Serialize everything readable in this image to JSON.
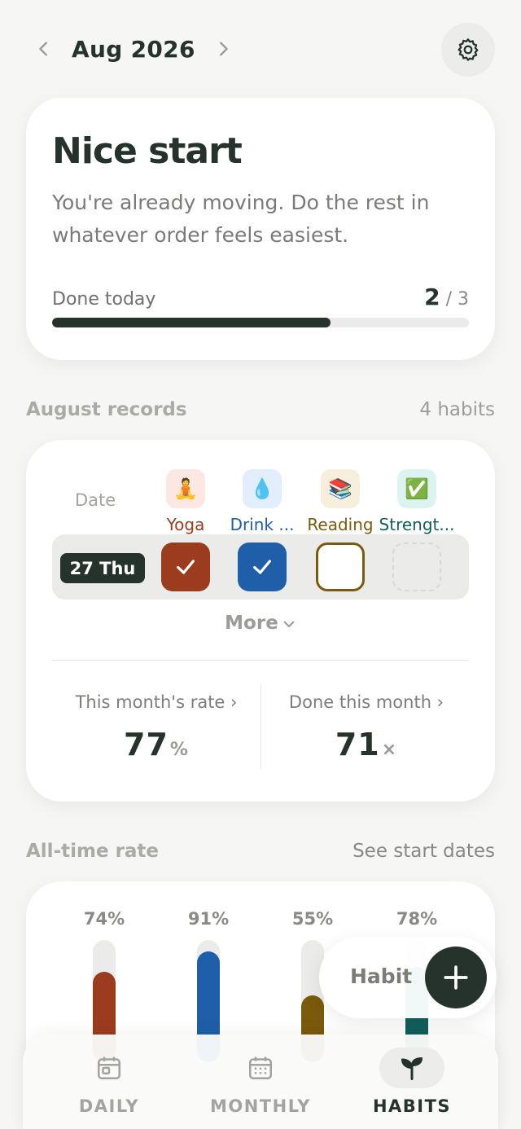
{
  "header": {
    "month": "Aug 2026"
  },
  "hero": {
    "title": "Nice start",
    "subtitle": "You're already moving. Do the rest in whatever order feels easiest.",
    "progress_label": "Done today",
    "done": "2",
    "separator": "/",
    "total": "3",
    "progress_fraction": 0.667
  },
  "records": {
    "title": "August records",
    "habit_count": "4 habits",
    "date_header": "Date",
    "habits": [
      {
        "name": "Yoga",
        "emoji": "🧘",
        "color": "#9b3c1e",
        "bg": "#fde7e3"
      },
      {
        "name": "Drink ...",
        "emoji": "💧",
        "color": "#1f5ea8",
        "bg": "#e3eefc"
      },
      {
        "name": "Reading",
        "emoji": "📚",
        "color": "#7a5a0c",
        "bg": "#f7eedc"
      },
      {
        "name": "Strengt...",
        "emoji": "✅",
        "color": "#12605c",
        "bg": "#dcf3f1"
      }
    ],
    "row": {
      "date": "27 Thu",
      "states": [
        "done",
        "done",
        "empty",
        "empty"
      ]
    },
    "more_label": "More",
    "rate_label": "This month's rate",
    "rate_value": "77",
    "rate_unit": "%",
    "done_label": "Done this month",
    "done_value": "71",
    "done_unit": "×"
  },
  "alltime": {
    "title": "All-time rate",
    "link": "See start dates",
    "bars": [
      {
        "label": "74%",
        "value": 0.74,
        "color": "#9b3c1e"
      },
      {
        "label": "91%",
        "value": 0.91,
        "color": "#1f5ea8"
      },
      {
        "label": "55%",
        "value": 0.55,
        "color": "#7a5a0c"
      },
      {
        "label": "78%",
        "value": 0.78,
        "color": "#12605c"
      }
    ]
  },
  "fab": {
    "label": "Habit"
  },
  "tabs": [
    {
      "label": "DAILY",
      "icon": "calendar-day-icon",
      "active": false
    },
    {
      "label": "MONTHLY",
      "icon": "calendar-month-icon",
      "active": false
    },
    {
      "label": "HABITS",
      "icon": "sprout-icon",
      "active": true
    }
  ],
  "colors": {
    "primary": "#25332c",
    "muted": "#a3a3a0"
  }
}
